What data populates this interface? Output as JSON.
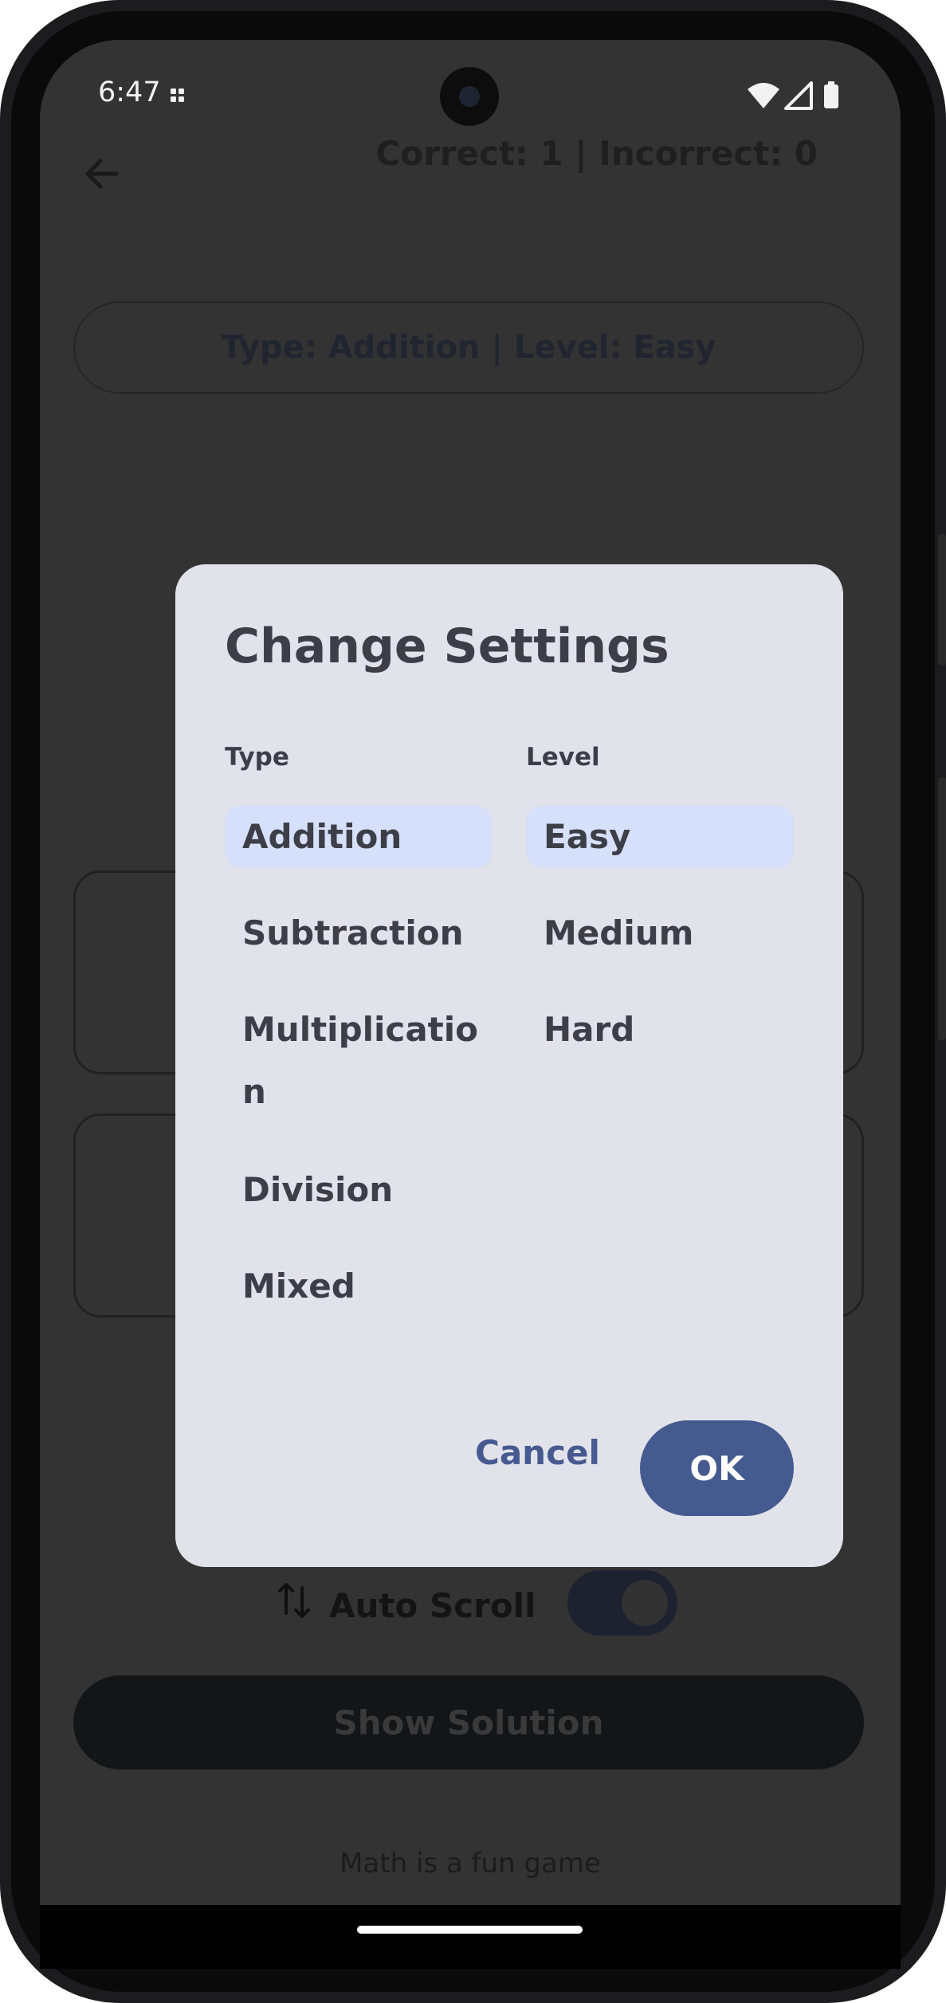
{
  "status_bar": {
    "time": "6:47"
  },
  "app_bar": {
    "score": "Correct: 1 | Incorrect: 0"
  },
  "quiz": {
    "type_level": "Type: Addition | Level: Easy"
  },
  "auto_scroll": {
    "label": "Auto Scroll",
    "enabled": true
  },
  "show_solution": {
    "label": "Show Solution"
  },
  "footer": {
    "text": "Math is a fun game"
  },
  "dialog": {
    "title": "Change Settings",
    "type_header": "Type",
    "level_header": "Level",
    "types": [
      {
        "label": "Addition",
        "selected": true
      },
      {
        "label": "Subtraction",
        "selected": false
      },
      {
        "label": "Multiplication",
        "selected": false
      },
      {
        "label": "Division",
        "selected": false
      },
      {
        "label": "Mixed",
        "selected": false
      }
    ],
    "levels": [
      {
        "label": "Easy",
        "selected": true
      },
      {
        "label": "Medium",
        "selected": false
      },
      {
        "label": "Hard",
        "selected": false
      }
    ],
    "cancel_label": "Cancel",
    "ok_label": "OK"
  },
  "colors": {
    "dialog_bg": "#e2e2ea",
    "selected_option": "#d7e0fa",
    "primary": "#455b8f",
    "scrim_screen": "#333333"
  }
}
